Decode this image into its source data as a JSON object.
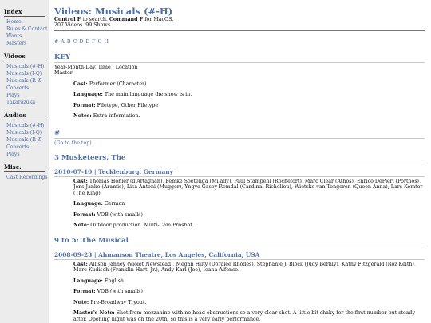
{
  "sidebar": {
    "sections": [
      {
        "title": "Index",
        "items": [
          {
            "label": "Home",
            "active": false
          },
          {
            "label": "Rules & Contact",
            "active": false
          },
          {
            "label": "Wants",
            "active": false
          },
          {
            "label": "Masters",
            "active": false
          }
        ]
      },
      {
        "title": "Videos",
        "items": [
          {
            "label": "Musicals (#-H)",
            "active": true
          },
          {
            "label": "Musicals (I-Q)",
            "active": false
          },
          {
            "label": "Musicals (R-Z)",
            "active": false
          },
          {
            "label": "Concerts",
            "active": false
          },
          {
            "label": "Plays",
            "active": false
          },
          {
            "label": "Takarazuka",
            "active": false
          }
        ]
      },
      {
        "title": "Audios",
        "items": [
          {
            "label": "Musicals (#-H)",
            "active": false
          },
          {
            "label": "Musicals (I-Q)",
            "active": false
          },
          {
            "label": "Musicals (R-Z)",
            "active": false
          },
          {
            "label": "Concerts",
            "active": false
          },
          {
            "label": "Plays",
            "active": false
          }
        ]
      },
      {
        "title": "Misc.",
        "items": [
          {
            "label": "Cast Recordings",
            "active": false
          }
        ]
      }
    ]
  },
  "page": {
    "title": "Videos: Musicals (#-H)",
    "help_ctrl": "Control F",
    "help_mid": " to search. ",
    "help_cmd": "Command F",
    "help_end": " for MacOS.",
    "counts": "207 Videos. 99 Shows.",
    "alpha_nav": [
      "#",
      "A",
      "B",
      "C",
      "D",
      "E",
      "F",
      "G",
      "H"
    ]
  },
  "key": {
    "heading": "KEY",
    "line1": "Year-Month-Day, Time | Location",
    "line2": "Master",
    "fields": [
      {
        "label": "Cast:",
        "value": " Performer (Character)"
      },
      {
        "label": "Language:",
        "value": " The main language the show is in."
      },
      {
        "label": "Format:",
        "value": " Filetype, Other Filetype"
      },
      {
        "label": "Notes:",
        "value": " Extra information."
      }
    ]
  },
  "section_hash": {
    "heading": "#",
    "go_top": "(Go to the top)"
  },
  "shows": [
    {
      "title": "3 Musketeers, The",
      "performances": [
        {
          "title": "2010-07-10 | Tecklenburg, Germany",
          "fields": [
            {
              "label": "Cast:",
              "value": " Thomas Hohler (d'Artagnan), Femke Soetenga (Milady), Paul Stampehl (Rochefort), Marc Clear (Athos), Enrico DePieri (Porthos), Jens Janke (Aramis), Lisa Antoni (Mugger), Yngve Gasoy-Romdal (Cardinal Richelieu), Wietske van Tongeren (Queen Anna), Lars Kemter (The King)."
            },
            {
              "label": "Language:",
              "value": " German"
            },
            {
              "label": "Format:",
              "value": " VOB (with smalls)"
            },
            {
              "label": "Note:",
              "value": " Outdoor production. Multi-Cam Proshot."
            }
          ]
        }
      ]
    },
    {
      "title": "9 to 5: The Musical",
      "performances": [
        {
          "title": "2008-09-23 | Ahmanson Theatre, Los Angeles, California, USA",
          "fields": [
            {
              "label": "Cast:",
              "value": " Allison Janney (Violet Newstead), Megan Hilty (Doralee Rhodes), Stephanie J. Block (Judy Bernly), Kathy Fitzgerald (Roz Keith), Marc Kudisch (Franklin Hart, Jr.), Andy Karl (Joe), Ioana Alfonso."
            },
            {
              "label": "Language:",
              "value": " English"
            },
            {
              "label": "Format:",
              "value": " VOB (with smalls)"
            },
            {
              "label": "Note:",
              "value": " Pre-Broadway Tryout."
            },
            {
              "label": "Master's Note:",
              "value": " Shot from mezzanine with no head obstructions so a very clear shot. A little bit shaky for the first number but steady after. Opening night was on the 20th, so this is a very early performance."
            }
          ]
        }
      ]
    }
  ]
}
